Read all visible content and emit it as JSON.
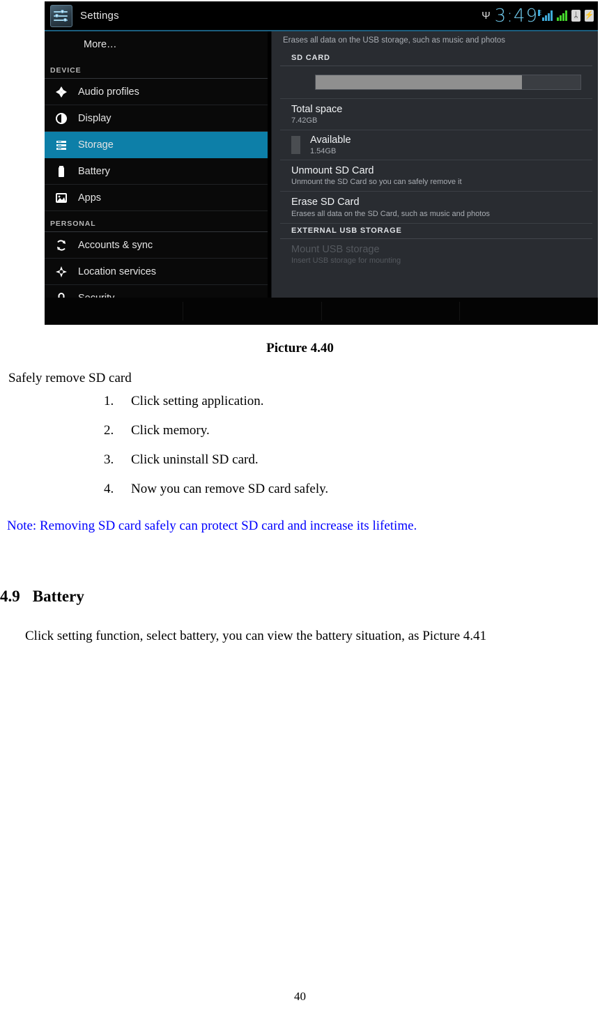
{
  "screenshot": {
    "actionbar": {
      "app_icon": "settings-sliders-icon",
      "title": "Settings"
    },
    "statusbar": {
      "usb_icon": "usb-icon",
      "clock": "3:49",
      "signal_edge_letter": "E",
      "signal_primary_icon": "signal-bars-blue-icon",
      "signal_secondary_icon": "signal-bars-green-icon",
      "bluetooth_glyph": "ᛦ",
      "battery_glyph": "⚡",
      "bluetooth_icon": "bluetooth-icon",
      "battery_icon": "battery-icon"
    },
    "sidebar": {
      "items": [
        {
          "label": "More…",
          "icon": "none",
          "type": "item",
          "selected": false
        },
        {
          "label": "DEVICE",
          "type": "header"
        },
        {
          "label": "Audio profiles",
          "icon": "audio-profiles-icon",
          "type": "item",
          "selected": false
        },
        {
          "label": "Display",
          "icon": "display-brightness-icon",
          "type": "item",
          "selected": false
        },
        {
          "label": "Storage",
          "icon": "storage-list-icon",
          "type": "item",
          "selected": true
        },
        {
          "label": "Battery",
          "icon": "battery-icon",
          "type": "item",
          "selected": false
        },
        {
          "label": "Apps",
          "icon": "apps-image-icon",
          "type": "item",
          "selected": false
        },
        {
          "label": "PERSONAL",
          "type": "header"
        },
        {
          "label": "Accounts & sync",
          "icon": "sync-icon",
          "type": "item",
          "selected": false
        },
        {
          "label": "Location services",
          "icon": "location-crosshair-icon",
          "type": "item",
          "selected": false
        },
        {
          "label": "Security",
          "icon": "lock-icon",
          "type": "item",
          "selected": false
        }
      ],
      "selected_color": "#0d7fa8"
    },
    "content": {
      "top_note": "Erases all data on the USB storage, such as music and photos",
      "sd_card_header": "SD CARD",
      "usage_bar": {
        "used_percent": 78,
        "fill_color": "#8f8f8f",
        "track_color": "#3a3d42"
      },
      "total_space": {
        "title": "Total space",
        "value": "7.42GB"
      },
      "available": {
        "title": "Available",
        "value": "1.54GB",
        "swatch_color": "#4a4d51"
      },
      "unmount": {
        "title": "Unmount SD Card",
        "subtitle": "Unmount the SD Card so you can safely remove it"
      },
      "erase": {
        "title": "Erase SD Card",
        "subtitle": "Erases all data on the SD Card, such as music and photos"
      },
      "external_header": "EXTERNAL USB STORAGE",
      "mount_usb": {
        "title": "Mount USB storage",
        "subtitle": "Insert USB storage for mounting",
        "disabled": true
      }
    }
  },
  "document": {
    "caption": "Picture 4.40",
    "lead": "Safely remove SD card",
    "steps": [
      "Click setting application.",
      "Click memory.",
      "Click uninstall SD card.",
      "Now you can remove SD card safely."
    ],
    "note": "Note: Removing SD card safely can protect SD card and increase its lifetime.",
    "note_color": "#0000ff",
    "section": {
      "number": "4.9",
      "title": "Battery",
      "body": "Click setting function, select battery, you can view the battery situation, as Picture 4.41"
    },
    "page_number": "40"
  }
}
